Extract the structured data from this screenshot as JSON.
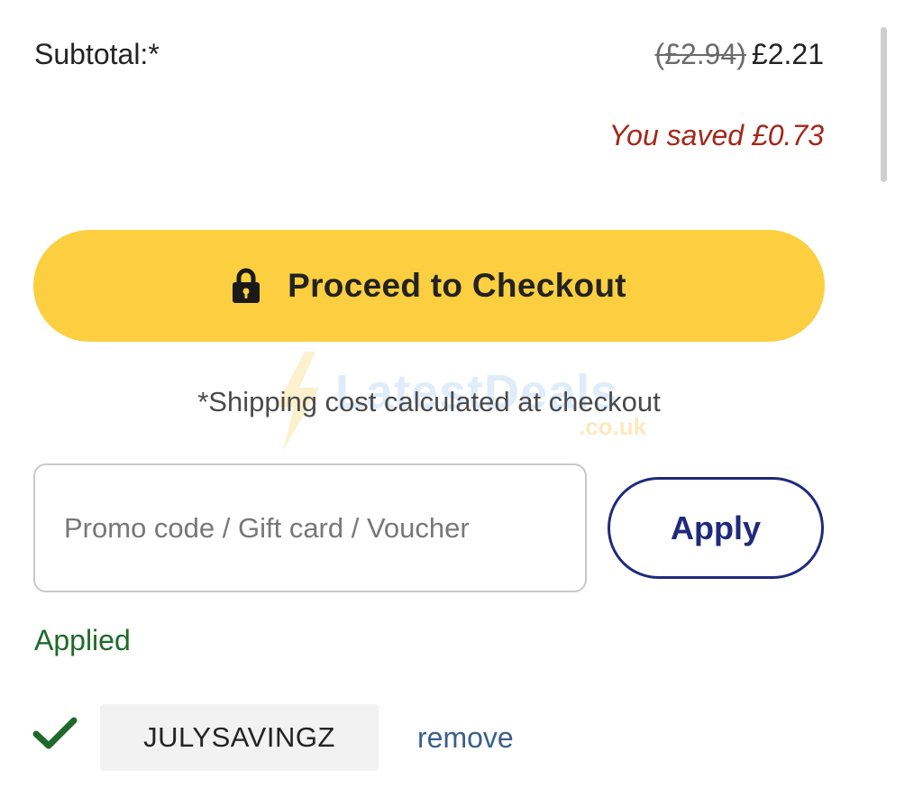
{
  "summary": {
    "subtotal_label": "Subtotal:*",
    "original_price": "(£2.94)",
    "current_price": "£2.21",
    "saved_text": "You saved £0.73"
  },
  "checkout": {
    "label": "Proceed to Checkout",
    "icon": "lock-icon",
    "color": "#fccf41"
  },
  "shipping_note": "*Shipping cost calculated at checkout",
  "watermark": {
    "text": "LatestDeals",
    "sub": ".co.uk"
  },
  "promo": {
    "placeholder": "Promo code / Gift card / Voucher",
    "value": "",
    "apply_label": "Apply",
    "applied_label": "Applied",
    "applied_code": "JULYSAVINGZ",
    "remove_label": "remove",
    "check_icon": "checkmark-icon"
  },
  "colors": {
    "accent_navy": "#1f2a7a",
    "saved_red": "#a3271a",
    "applied_green": "#1e6a2a",
    "link_blue": "#3a5f8a"
  }
}
